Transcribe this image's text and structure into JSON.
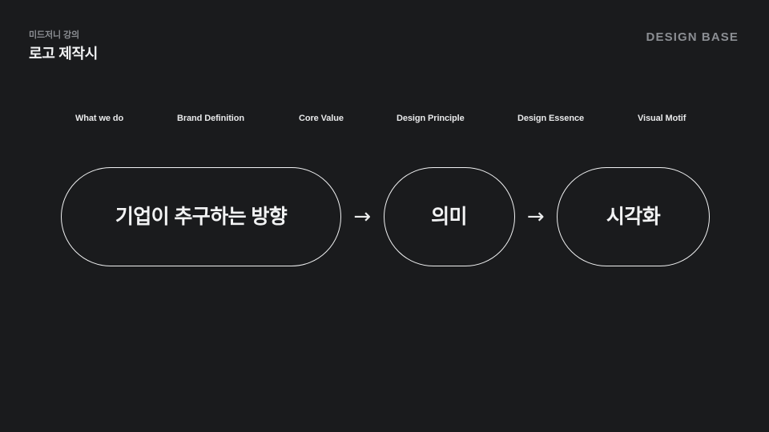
{
  "header": {
    "eyebrow": "미드저니 강의",
    "title": "로고 제작시",
    "brand": "DESIGN BASE"
  },
  "steps": {
    "labels": [
      "What we do",
      "Brand Definition",
      "Core Value",
      "Design Principle",
      "Design Essence",
      "Visual Motif"
    ]
  },
  "flow": {
    "nodes": [
      {
        "text": "기업이 추구하는 방향"
      },
      {
        "text": "의미"
      },
      {
        "text": "시각화"
      }
    ],
    "connectors": [
      {
        "glyph": "→"
      },
      {
        "glyph": "→"
      }
    ]
  },
  "colors": {
    "background": "#1a1b1d",
    "text_primary": "#f2f3f4",
    "text_muted": "#8b8e93",
    "stroke": "#f0f1f2"
  }
}
